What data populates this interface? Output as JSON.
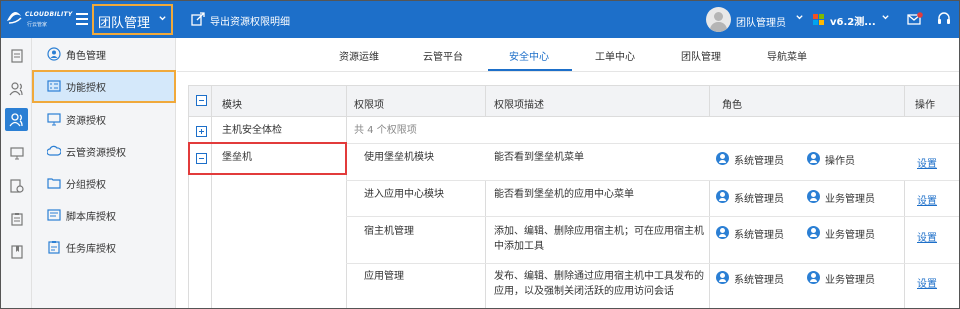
{
  "brand": {
    "name": "CLOUDBILITY",
    "subtitle": "行云管家"
  },
  "header": {
    "team_selector": "团队管理",
    "export_label": "导出资源权限明细",
    "user_name": "团队管理员",
    "version": "v6.2测...",
    "colors": {
      "bar": "#1d6fc9",
      "highlight": "#f0a93b"
    }
  },
  "rail": {
    "icons": [
      "document-icon",
      "users-icon",
      "team-icon",
      "monitor-icon",
      "gear-doc-icon",
      "clipboard-icon",
      "book-icon"
    ]
  },
  "submenu": {
    "items": [
      {
        "label": "角色管理",
        "icon": "role-icon"
      },
      {
        "label": "功能授权",
        "icon": "function-icon"
      },
      {
        "label": "资源授权",
        "icon": "monitor-icon"
      },
      {
        "label": "云管资源授权",
        "icon": "cloud-icon"
      },
      {
        "label": "分组授权",
        "icon": "folder-icon"
      },
      {
        "label": "脚本库授权",
        "icon": "script-icon"
      },
      {
        "label": "任务库授权",
        "icon": "task-icon"
      }
    ]
  },
  "tabs": [
    "资源运维",
    "云管平台",
    "安全中心",
    "工单中心",
    "团队管理",
    "导航菜单"
  ],
  "table": {
    "headers": [
      "模块",
      "权限项",
      "权限项描述",
      "角色",
      "操作"
    ],
    "modules": [
      {
        "name": "主机安全体检",
        "note": "共 4 个权限项"
      },
      {
        "name": "堡垒机"
      }
    ],
    "rows": [
      {
        "perm": "使用堡垒机模块",
        "desc": "能否看到堡垒机菜单",
        "role1": "系统管理员",
        "role2": "操作员",
        "action": "设置"
      },
      {
        "perm": "进入应用中心模块",
        "desc": "能否看到堡垒机的应用中心菜单",
        "role1": "系统管理员",
        "role2": "业务管理员",
        "action": "设置"
      },
      {
        "perm": "宿主机管理",
        "desc1": "添加、编辑、删除应用宿主机；可在应用宿主机",
        "desc2": "中添加工具",
        "role1": "系统管理员",
        "role2": "业务管理员",
        "action": "设置"
      },
      {
        "perm": "应用管理",
        "desc1": "发布、编辑、删除通过应用宿主机中工具发布的",
        "desc2": "应用，以及强制关闭活跃的应用访问会话",
        "role1": "系统管理员",
        "role2": "业务管理员",
        "action": "设置"
      }
    ]
  }
}
